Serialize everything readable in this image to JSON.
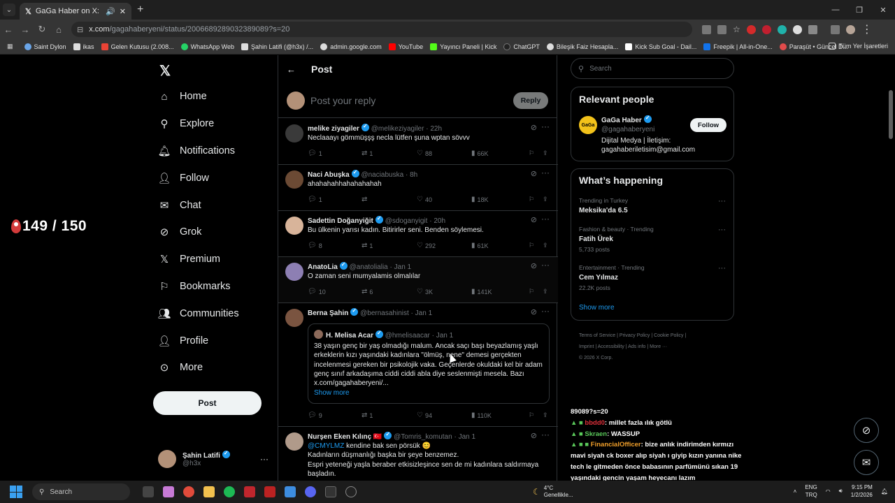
{
  "browser": {
    "tab_title": "GaGa Haber on X: \"Cem Yıl",
    "url_domain": "x.com",
    "url_path": "/gagahaberyeni/status/2006689289032389089?s=20"
  },
  "bookmarks": [
    "Saint Dylon",
    "ikas",
    "Gelen Kutusu (2.008...",
    "WhatsApp Web",
    "Şahin Latifi (@h3x) /...",
    "admin.google.com",
    "YouTube",
    "Yayıncı Paneli | Kick",
    "ChatGPT",
    "Bileşik Faiz Hesapla...",
    "Kick Sub Goal - Dail...",
    "Freepik | All-in-One...",
    "Paraşüt • Güncel D..."
  ],
  "bookmarks_right": "Tüm Yer İşaretleri",
  "overlay_counter": "149 / 150",
  "nav": [
    {
      "icon": "home-icon",
      "label": "Home"
    },
    {
      "icon": "explore-icon",
      "label": "Explore"
    },
    {
      "icon": "bell-icon",
      "label": "Notifications"
    },
    {
      "icon": "follow-icon",
      "label": "Follow"
    },
    {
      "icon": "mail-icon",
      "label": "Chat"
    },
    {
      "icon": "grok-icon",
      "label": "Grok"
    },
    {
      "icon": "x-icon",
      "label": "Premium"
    },
    {
      "icon": "bookmark-icon",
      "label": "Bookmarks"
    },
    {
      "icon": "communities-icon",
      "label": "Communities"
    },
    {
      "icon": "profile-icon",
      "label": "Profile"
    },
    {
      "icon": "more-icon",
      "label": "More"
    }
  ],
  "post_button": "Post",
  "account": {
    "name": "Şahin Latifi",
    "handle": "@h3x"
  },
  "feed": {
    "title": "Post",
    "reply_placeholder": "Post your reply",
    "reply_button": "Reply"
  },
  "tweets": [
    {
      "name": "melike ziyagiler",
      "handle": "@melikeziyagiler",
      "time": "22h",
      "text": "Neclaaayı gömmüşşş necla lütfen şuna wptan sövvv",
      "replies": "1",
      "reposts": "1",
      "likes": "88",
      "views": "66K"
    },
    {
      "name": "Naci Abuşka",
      "handle": "@naciabuska",
      "time": "8h",
      "text": "ahahahahhahahahahah",
      "replies": "1",
      "reposts": "",
      "likes": "40",
      "views": "18K"
    },
    {
      "name": "Sadettin Doğanyiğit",
      "handle": "@sdoganyigit",
      "time": "20h",
      "text": "Bu ülkenin yarısı kadın. Bitirirler seni. Benden söylemesi.",
      "replies": "8",
      "reposts": "1",
      "likes": "292",
      "views": "61K"
    },
    {
      "name": "AnatoLia",
      "handle": "@anatolialia",
      "time": "Jan 1",
      "text": "O zaman seni mumyalamis olmalılar",
      "replies": "10",
      "reposts": "6",
      "likes": "3K",
      "views": "141K"
    },
    {
      "name": "Berna Şahin",
      "handle": "@bernasahinist",
      "time": "Jan 1",
      "text": "",
      "replies": "9",
      "reposts": "1",
      "likes": "94",
      "views": "110K",
      "quote": {
        "name": "H. Melisa Acar",
        "handle": "@hmelisaacar",
        "time": "Jan 1",
        "text": "38 yaşın genç bir yaş olmadığı malum. Ancak saçı başı beyazlamış yaşlı erkeklerin kızı yaşındaki kadınlara \"ölmüş, nene\" demesi gerçekten incelenmesi gereken bir psikolojik vaka. Geçenlerde okuldaki kel bir adam genç sınıf arkadaşıma ciddi ciddi abla diye seslenmişti mesela. Bazı x.com/gagahaberyeni/...",
        "show_more": "Show more"
      }
    },
    {
      "name": "Nurşen Eken Kılınç 🇹🇷",
      "handle": "@Tomris_komutan",
      "time": "Jan 1",
      "mention": "@CMYLMZ",
      "text1": "kendine bak sen pörsük 😊",
      "text2": "Kadınların düşmanlığı başka bir şeye benzemez.",
      "text3": "Espri yeteneği yaşla beraber etkisizleşince sen de mi kadınlara saldırmaya başladın."
    }
  ],
  "search_placeholder": "Search",
  "relevant": {
    "title": "Relevant people",
    "name": "GaGa Haber",
    "handle": "@gagahaberyeni",
    "bio": "Dijital Medya | İletişim: gagahaberiletisim@gmail.com",
    "follow": "Follow",
    "avatar_text": "GaGa"
  },
  "happening": {
    "title": "What’s happening",
    "trends": [
      {
        "meta": "Trending in Turkey",
        "title": "Meksika'da 6.5",
        "posts": ""
      },
      {
        "meta": "Fashion & beauty · Trending",
        "title": "Fatih Ürek",
        "posts": "5,733 posts"
      },
      {
        "meta": "Entertainment · Trending",
        "title": "Cem Yılmaz",
        "posts": "22.2K posts"
      }
    ],
    "show_more": "Show more"
  },
  "footer": {
    "line1": "Terms of Service  |  Privacy Policy  |  Cookie Policy  |",
    "line2": "Imprint  |  Accessibility  |  Ads info  |  More ···",
    "line3": "© 2026 X Corp."
  },
  "chat": [
    {
      "user": "",
      "text": "89089?s=20"
    },
    {
      "user": "bbdd0",
      "text": ": millet fazla ılık götlü"
    },
    {
      "user": "Skraen",
      "text": ": WASSUP"
    },
    {
      "user": "FinancialOfficer",
      "text": ": bize anlık indirimden kırmızı mavi siyah ck boxer alıp siyah ı giyip kızın yanına nike tech le gitmeden önce babasının parfümünü sıkan 19 yaşındaki gencin yaşam heyecanı lazım"
    }
  ],
  "taskbar": {
    "search": "Search",
    "weather_temp": "4°C",
    "weather_desc": "Genellikle...",
    "lang1": "ENG",
    "lang2": "TRQ",
    "time": "9:15 PM",
    "date": "1/2/2026"
  }
}
